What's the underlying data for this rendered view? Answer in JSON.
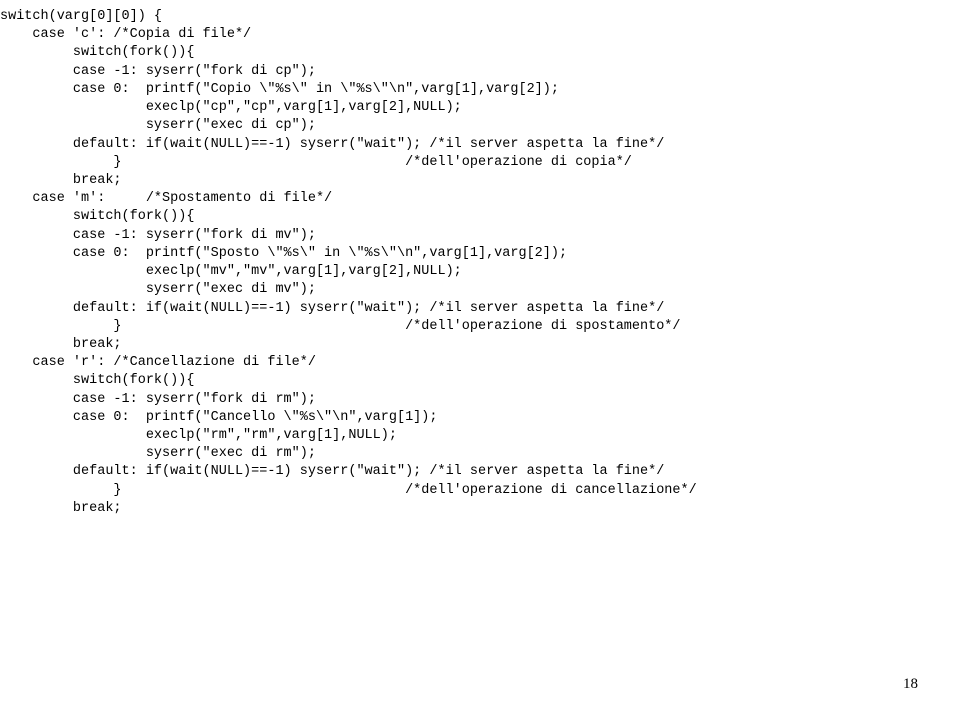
{
  "code": "switch(varg[0][0]) {\n    case 'c': /*Copia di file*/\n         switch(fork()){\n         case -1: syserr(\"fork di cp\");\n         case 0:  printf(\"Copio \\\"%s\\\" in \\\"%s\\\"\\n\",varg[1],varg[2]);\n                  execlp(\"cp\",\"cp\",varg[1],varg[2],NULL);\n                  syserr(\"exec di cp\");\n         default: if(wait(NULL)==-1) syserr(\"wait\"); /*il server aspetta la fine*/\n              }                                   /*dell'operazione di copia*/\n         break;\n    case 'm':     /*Spostamento di file*/\n         switch(fork()){\n         case -1: syserr(\"fork di mv\");\n         case 0:  printf(\"Sposto \\\"%s\\\" in \\\"%s\\\"\\n\",varg[1],varg[2]);\n                  execlp(\"mv\",\"mv\",varg[1],varg[2],NULL);\n                  syserr(\"exec di mv\");\n         default: if(wait(NULL)==-1) syserr(\"wait\"); /*il server aspetta la fine*/\n              }                                   /*dell'operazione di spostamento*/\n         break;\n    case 'r': /*Cancellazione di file*/\n         switch(fork()){\n         case -1: syserr(\"fork di rm\");\n         case 0:  printf(\"Cancello \\\"%s\\\"\\n\",varg[1]);\n                  execlp(\"rm\",\"rm\",varg[1],NULL);\n                  syserr(\"exec di rm\");\n         default: if(wait(NULL)==-1) syserr(\"wait\"); /*il server aspetta la fine*/\n              }                                   /*dell'operazione di cancellazione*/\n         break;",
  "page_number": "18"
}
